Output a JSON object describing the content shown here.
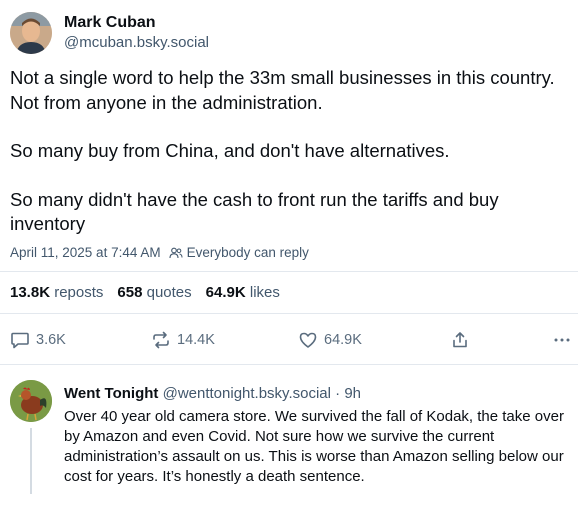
{
  "post": {
    "author": {
      "display_name": "Mark Cuban",
      "handle": "@mcuban.bsky.social"
    },
    "paragraphs": [
      "Not a single word to help the 33m small businesses in this country.  Not from anyone in the administration.",
      "So many buy from China, and don't have alternatives.",
      "So many didn't have the cash to front run the tariffs and buy inventory"
    ],
    "timestamp": "April 11, 2025 at 7:44 AM",
    "reply_setting": "Everybody can reply",
    "stats": {
      "reposts_count": "13.8K",
      "reposts_label": "reposts",
      "quotes_count": "658",
      "quotes_label": "quotes",
      "likes_count": "64.9K",
      "likes_label": "likes"
    },
    "actions": {
      "reply_count": "3.6K",
      "repost_count": "14.4K",
      "like_count": "64.9K",
      "icons": [
        "reply-icon",
        "repost-icon",
        "like-icon",
        "share-icon",
        "more-icon"
      ]
    }
  },
  "reply": {
    "display_name": "Went Tonight",
    "handle": "@wenttonight.bsky.social",
    "separator": "·",
    "time": "9h",
    "text": "Over 40 year old camera store.  We survived the fall of Kodak, the take over by Amazon and even Covid.  Not sure how we survive the current administration’s assault on us.  This is worse than Amazon selling below our cost for years.  It’s honestly a death sentence."
  },
  "colors": {
    "text_primary": "#0b0f14",
    "text_secondary": "#42576c",
    "icon": "#5a6c7e",
    "divider": "#e3e8ee"
  }
}
